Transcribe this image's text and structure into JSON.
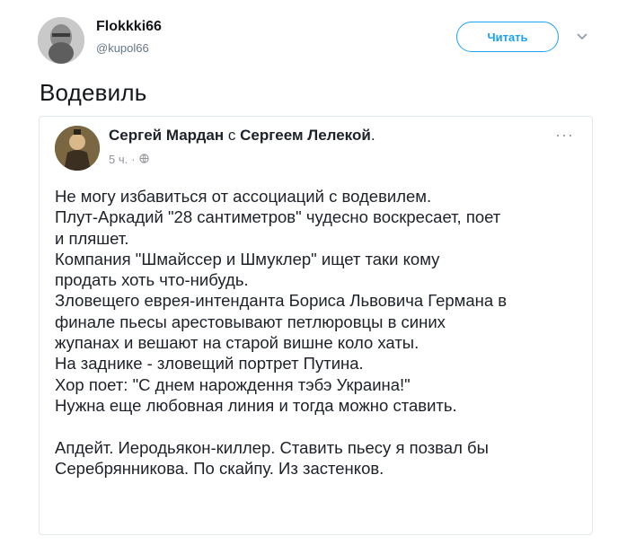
{
  "tweet": {
    "display_name": "Flokkki66",
    "handle": "@kupol66",
    "follow_label": "Читать",
    "text": "Водевиль"
  },
  "embedded_post": {
    "author": "Сергей Мардан",
    "with_word": "с",
    "tagged": "Сергеем Лелекой",
    "time": "5 ч.",
    "body_paragraph_1": [
      "Не могу избавиться от ассоциаций с водевилем.",
      "Плут-Аркадий \"28 сантиметров\" чудесно воскресает, поет",
      "и пляшет.",
      "Компания \"Шмайссер и Шмуклер\" ищет таки кому",
      "продать хоть что-нибудь.",
      "Зловещего еврея-интенданта Бориса Львовича Германа в",
      "финале пьесы арестовывают петлюровцы в синих",
      "жупанах и вешают на старой вишне коло хаты.",
      "На заднике - зловещий портрет Путина.",
      "Хор поет: \"С днем нарождення тэбэ Украина!\"",
      "Нужна еще любовная линия и тогда можно ставить."
    ],
    "body_paragraph_2": [
      "Апдейт. Иеродьякон-киллер. Ставить пьесу я позвал бы",
      "Серебрянникова. По скайпу. Из застенков."
    ]
  },
  "icons": {
    "chevron": "chevron-down-icon",
    "globe": "globe-icon",
    "more": "more-options-icon"
  },
  "colors": {
    "accent": "#1da1f2",
    "text": "#14171a",
    "secondary": "#657786",
    "fb_text": "#1d2129",
    "fb_meta": "#90949c",
    "border": "#e1e8ed"
  }
}
